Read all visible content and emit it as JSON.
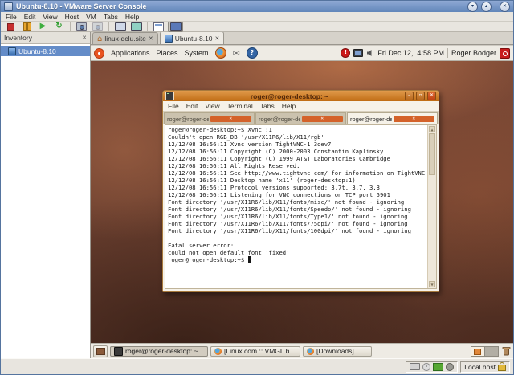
{
  "window": {
    "title": "Ubuntu-8.10 - VMware Server Console",
    "menu": [
      "File",
      "Edit",
      "View",
      "Host",
      "VM",
      "Tabs",
      "Help"
    ],
    "inventory": {
      "header": "Inventory",
      "vm": "Ubuntu-8.10"
    },
    "tabs": {
      "host_tab": "linux-qclu.site",
      "vm_tab": "Ubuntu-8.10"
    },
    "status": {
      "host": "Local host"
    }
  },
  "guest": {
    "panel": {
      "applications": "Applications",
      "places": "Places",
      "system": "System",
      "clock": "Fri Dec 12,  4:58 PM",
      "user": "Roger Bodger"
    },
    "terminal": {
      "title": "roger@roger-desktop: ~",
      "menu": [
        "File",
        "Edit",
        "View",
        "Terminal",
        "Tabs",
        "Help"
      ],
      "tabs": [
        "roger@roger-desktop: /usr/...",
        "roger@roger-desktop: /etc/...",
        "roger@roger-desktop: ~"
      ],
      "lines": [
        "roger@roger-desktop:~$ Xvnc :1",
        "Couldn't open RGB_DB '/usr/X11R6/lib/X11/rgb'",
        "12/12/08 16:56:11 Xvnc version TightVNC-1.3dev7",
        "12/12/08 16:56:11 Copyright (C) 2000-2003 Constantin Kaplinsky",
        "12/12/08 16:56:11 Copyright (C) 1999 AT&T Laboratories Cambridge",
        "12/12/08 16:56:11 All Rights Reserved.",
        "12/12/08 16:56:11 See http://www.tightvnc.com/ for information on TightVNC",
        "12/12/08 16:56:11 Desktop name 'x11' (roger-desktop:1)",
        "12/12/08 16:56:11 Protocol versions supported: 3.7t, 3.7, 3.3",
        "12/12/08 16:56:11 Listening for VNC connections on TCP port 5901",
        "Font directory '/usr/X11R6/lib/X11/fonts/misc/' not found - ignoring",
        "Font directory '/usr/X11R6/lib/X11/fonts/Speedo/' not found - ignoring",
        "Font directory '/usr/X11R6/lib/X11/fonts/Type1/' not found - ignoring",
        "Font directory '/usr/X11R6/lib/X11/fonts/75dpi/' not found - ignoring",
        "Font directory '/usr/X11R6/lib/X11/fonts/100dpi/' not found - ignoring",
        "",
        "Fatal server error:",
        "could not open default font 'fixed'",
        "roger@roger-desktop:~$ "
      ]
    },
    "taskbar": {
      "win1": "roger@roger-desktop: ~",
      "win2": "[Linux.com :: VMGL br...",
      "win3": "[Downloads]"
    }
  },
  "glyphs": {
    "minimize": "▾",
    "maximize": "▴",
    "close": "✕",
    "term_minimize": "–",
    "term_maximize": "▫",
    "term_close": "✕",
    "tab_close": "✕",
    "inv_close": "✕",
    "home": "⌂",
    "mail": "✉",
    "help": "?",
    "update": "!",
    "play": "▶",
    "reset": "↻",
    "scroll_up": "▲",
    "scroll_down": "▼"
  },
  "colors": {
    "ubuntu_orange": "#dd4814",
    "titlebar_blue": "#7191c0",
    "selection_blue": "#648cc8",
    "terminal_titlebar": "#c06c14",
    "wallpaper_brown": "#6b4131"
  }
}
